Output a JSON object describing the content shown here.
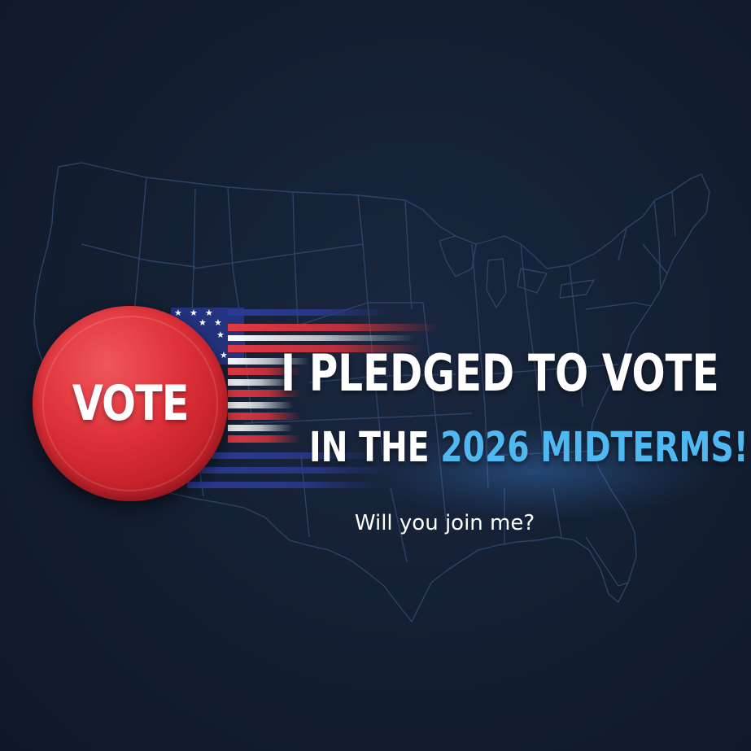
{
  "badge": {
    "label": "VOTE"
  },
  "headline": {
    "line1": "I PLEDGED TO VOTE",
    "line2_prefix": "IN THE ",
    "line2_accent": "2026 MIDTERMS!"
  },
  "subline": "Will you join me?",
  "colors": {
    "background": "#121c2e",
    "badge_red": "#dc2e36",
    "accent_blue": "#4fb8f0",
    "flag_navy": "#2a3a8f",
    "map_lines": "#2a4466"
  },
  "icons": {
    "map": "us-map-outline",
    "flag": "us-flag-streak",
    "badge": "vote-button-badge"
  }
}
